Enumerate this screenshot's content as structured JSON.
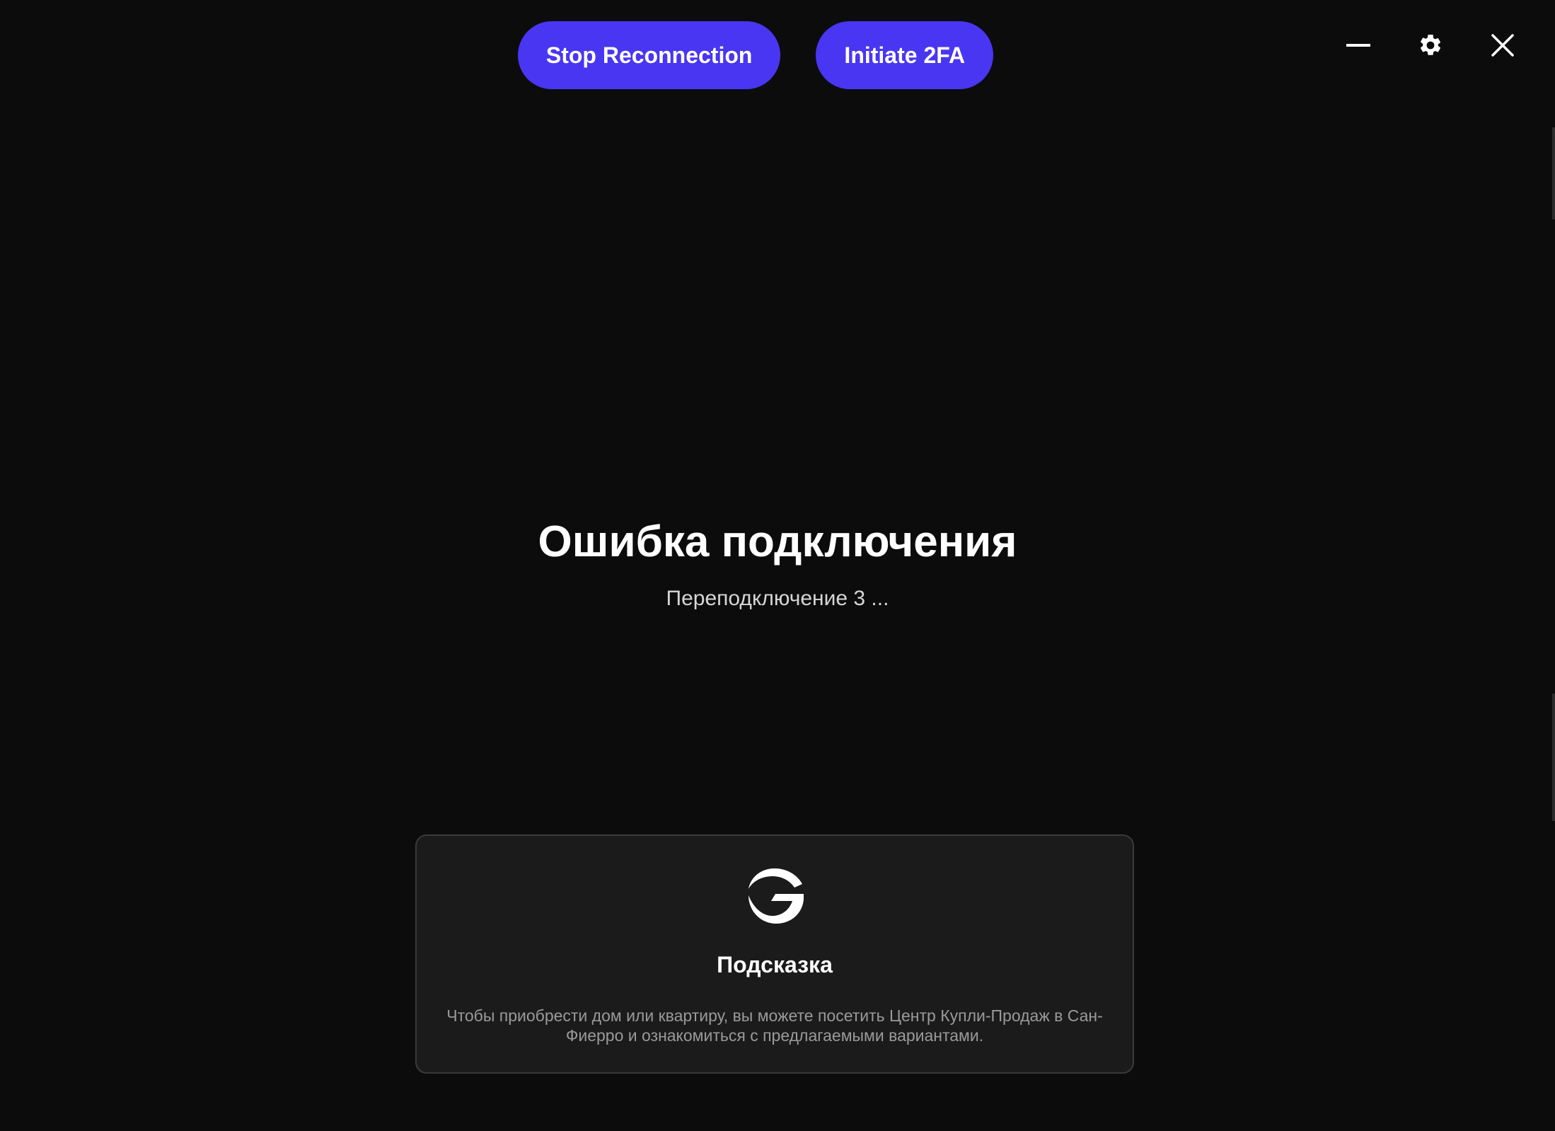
{
  "top_actions": {
    "stop_reconnection": "Stop Reconnection",
    "initiate_2fa": "Initiate 2FA"
  },
  "window_controls": {
    "minimize_icon": "minimize-icon",
    "settings_icon": "gear-icon",
    "close_icon": "close-icon"
  },
  "status": {
    "title": "Ошибка подключения",
    "subtitle": "Переподключение 3 ..."
  },
  "hint": {
    "logo_icon": "brand-logo-icon",
    "title": "Подсказка",
    "text": "Чтобы приобрести дом или квартиру, вы можете посетить Центр Купли-Продаж в Сан-Фиерро и ознакомиться с предлагаемыми вариантами."
  },
  "colors": {
    "background": "#0c0c0c",
    "accent": "#4936f2",
    "card_background": "#1b1b1b",
    "card_border": "#3a3a3a",
    "muted_text": "#9a9a9a"
  }
}
